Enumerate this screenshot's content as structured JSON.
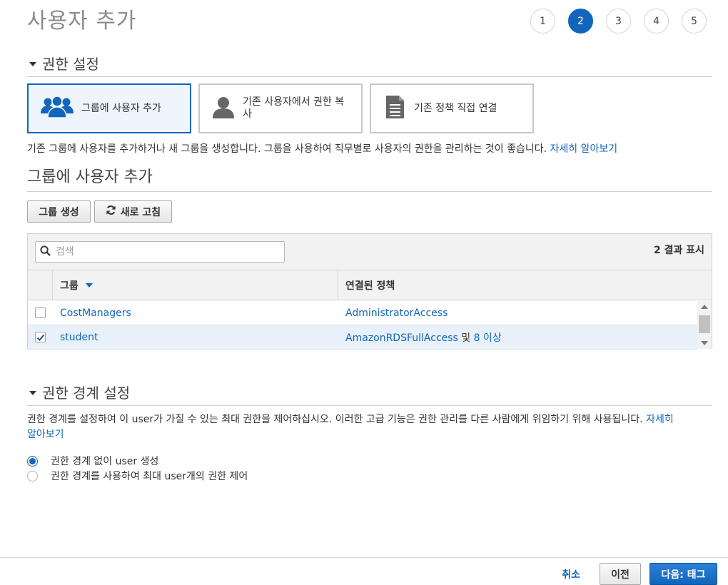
{
  "page": {
    "title": "사용자 추가"
  },
  "steps": [
    "1",
    "2",
    "3",
    "4",
    "5"
  ],
  "active_step": "2",
  "permissions": {
    "section_title": "권한 설정",
    "options": [
      {
        "label": "그룹에 사용자 추가",
        "icon": "group-icon",
        "selected": true
      },
      {
        "label": "기존 사용자에서 권한 복사",
        "icon": "user-icon",
        "selected": false
      },
      {
        "label": "기존 정책 직접 연결",
        "icon": "document-icon",
        "selected": false
      }
    ],
    "description": "기존 그룹에 사용자를 추가하거나 새 그룹을 생성합니다. 그룹을 사용하여 직무별로 사용자의 권한을 관리하는 것이 좋습니다.",
    "learn_more": "자세히 알아보기"
  },
  "add_to_group": {
    "title": "그룹에 사용자 추가",
    "create_group_label": "그룹 생성",
    "refresh_label": "새로 고침",
    "search_placeholder": "검색",
    "result_count": "2 결과 표시",
    "columns": {
      "group": "그룹",
      "policies": "연결된 정책"
    },
    "rows": [
      {
        "group": "CostManagers",
        "policy": "AdministratorAccess",
        "policy_suffix": "",
        "policy_more": "",
        "checked": false
      },
      {
        "group": "student",
        "policy": "AmazonRDSFullAccess",
        "policy_suffix": " 및 ",
        "policy_more": "8 이상",
        "checked": true
      }
    ]
  },
  "boundary": {
    "section_title": "권한 경계 설정",
    "description": "권한 경계를 설정하여 이 user가 가질 수 있는 최대 권한을 제어하십시오. 이러한 고급 기능은 권한 관리를 다른 사람에게 위임하기 위해 사용됩니다.",
    "learn_more_1": "자세히",
    "learn_more_2": "알아보기",
    "options": [
      {
        "label": "권한 경계 없이 user 생성",
        "selected": true
      },
      {
        "label": "권한 경계를 사용하여 최대 user개의 권한 제어",
        "selected": false
      }
    ]
  },
  "footer": {
    "cancel": "취소",
    "previous": "이전",
    "next": "다음: 태그"
  },
  "colors": {
    "accent": "#1166bb",
    "selected_row": "#e8f1fa",
    "link": "#1166bb"
  }
}
